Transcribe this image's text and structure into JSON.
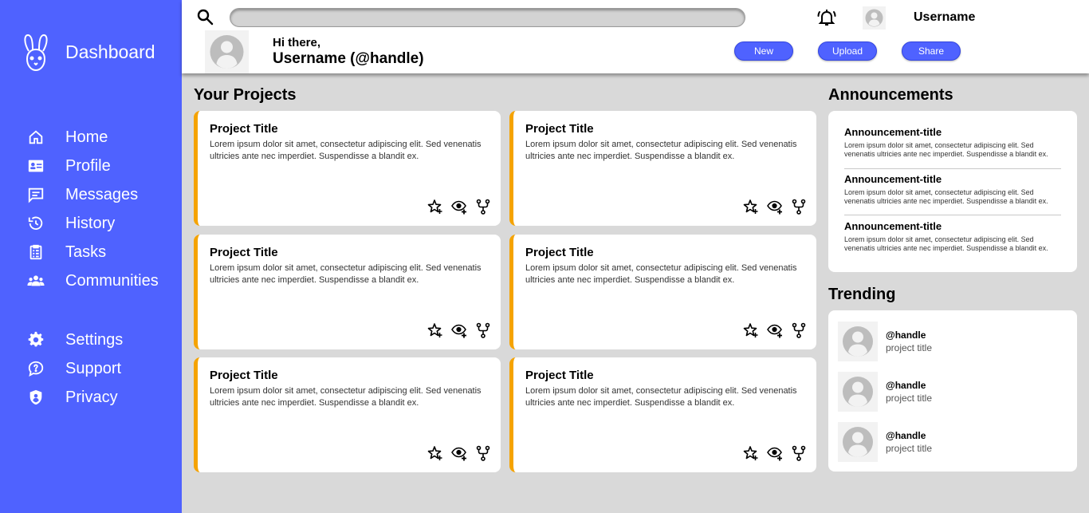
{
  "colors": {
    "accent": "#4f62ff",
    "card_stripe": "#f5a300",
    "background": "#d9d9d9"
  },
  "sidebar": {
    "brand_icon": "rabbit-logo-icon",
    "brand_title": "Dashboard",
    "items": [
      {
        "label": "Home",
        "icon": "home-icon"
      },
      {
        "label": "Profile",
        "icon": "id-card-icon"
      },
      {
        "label": "Messages",
        "icon": "message-icon"
      },
      {
        "label": "History",
        "icon": "history-icon"
      },
      {
        "label": "Tasks",
        "icon": "clipboard-icon"
      },
      {
        "label": "Communities",
        "icon": "people-icon"
      }
    ],
    "secondary_items": [
      {
        "label": "Settings",
        "icon": "gear-icon"
      },
      {
        "label": "Support",
        "icon": "help-chat-icon"
      },
      {
        "label": "Privacy",
        "icon": "shield-icon"
      }
    ]
  },
  "header": {
    "username": "Username",
    "greeting": "Hi there,",
    "display_name": "Username (@handle)",
    "buttons": {
      "new": "New",
      "upload": "Upload",
      "share": "Share"
    }
  },
  "projects": {
    "title": "Your Projects",
    "items": [
      {
        "title": "Project Title",
        "description": "Lorem ipsum dolor sit amet, consectetur adipiscing elit. Sed venenatis ultricies ante nec imperdiet. Suspendisse a blandit ex."
      },
      {
        "title": "Project Title",
        "description": "Lorem ipsum dolor sit amet, consectetur adipiscing elit. Sed venenatis ultricies ante nec imperdiet. Suspendisse a blandit ex."
      },
      {
        "title": "Project Title",
        "description": "Lorem ipsum dolor sit amet, consectetur adipiscing elit. Sed venenatis ultricies ante nec imperdiet. Suspendisse a blandit ex."
      },
      {
        "title": "Project Title",
        "description": "Lorem ipsum dolor sit amet, consectetur adipiscing elit. Sed venenatis ultricies ante nec imperdiet. Suspendisse a blandit ex."
      },
      {
        "title": "Project Title",
        "description": "Lorem ipsum dolor sit amet, consectetur adipiscing elit. Sed venenatis ultricies ante nec imperdiet. Suspendisse a blandit ex."
      },
      {
        "title": "Project Title",
        "description": "Lorem ipsum dolor sit amet, consectetur adipiscing elit. Sed venenatis ultricies ante nec imperdiet. Suspendisse a blandit ex."
      }
    ]
  },
  "announcements": {
    "title": "Announcements",
    "items": [
      {
        "title": "Announcement-title",
        "description": "Lorem ipsum dolor sit amet, consectetur adipiscing elit. Sed venenatis ultricies ante nec imperdiet. Suspendisse a blandit ex."
      },
      {
        "title": "Announcement-title",
        "description": "Lorem ipsum dolor sit amet, consectetur adipiscing elit. Sed venenatis ultricies ante nec imperdiet. Suspendisse a blandit ex."
      },
      {
        "title": "Announcement-title",
        "description": "Lorem ipsum dolor sit amet, consectetur adipiscing elit. Sed venenatis ultricies ante nec imperdiet. Suspendisse a blandit ex."
      }
    ]
  },
  "trending": {
    "title": "Trending",
    "items": [
      {
        "handle": "@handle",
        "project": "project title"
      },
      {
        "handle": "@handle",
        "project": "project title"
      },
      {
        "handle": "@handle",
        "project": "project title"
      }
    ]
  }
}
